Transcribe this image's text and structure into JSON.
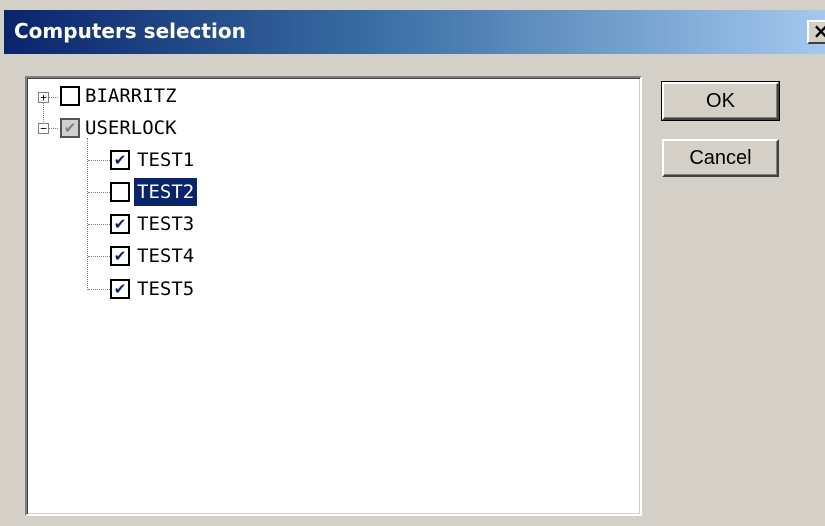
{
  "window": {
    "title": "Computers selection",
    "close_label": "×"
  },
  "tree": {
    "nodes": [
      {
        "label": "BIARRITZ",
        "expander": "+",
        "checked": "none"
      },
      {
        "label": "USERLOCK",
        "expander": "−",
        "checked": "partial"
      },
      {
        "label": "TEST1",
        "checked": "checked"
      },
      {
        "label": "TEST2",
        "checked": "unchecked",
        "selected": true
      },
      {
        "label": "TEST3",
        "checked": "checked"
      },
      {
        "label": "TEST4",
        "checked": "checked"
      },
      {
        "label": "TEST5",
        "checked": "checked"
      }
    ]
  },
  "buttons": {
    "ok_label": "OK",
    "cancel_label": "Cancel"
  },
  "colors": {
    "selection": "#0a246a",
    "title_gradient_start": "#0a246a",
    "title_gradient_end": "#a6caf0"
  }
}
